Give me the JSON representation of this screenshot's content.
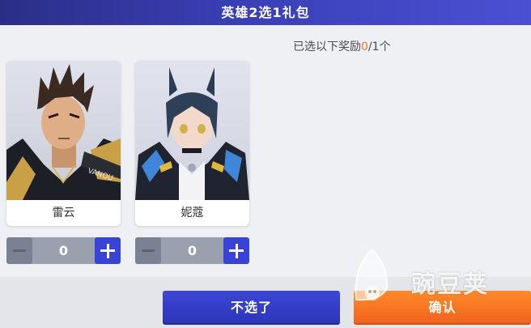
{
  "dialog": {
    "title": "英雄2选1礼包"
  },
  "selection": {
    "prefix": "已选以下奖励",
    "selected": "0",
    "separator": "/",
    "max": "1",
    "suffix": "个",
    "highlight_color": "#f07b2a"
  },
  "heroes": [
    {
      "name": "雷云",
      "quantity": "0",
      "portrait_icon": "hero-portrait-leiyun"
    },
    {
      "name": "妮蔻",
      "quantity": "0",
      "portrait_icon": "hero-portrait-nikou"
    }
  ],
  "buttons": {
    "skip_label": "不选了",
    "confirm_label": "确认",
    "skip_color": "#3a42d0",
    "confirm_color": "#f26e22"
  },
  "watermark": {
    "text": "豌豆荚",
    "icon": "pea-pod-logo-icon"
  }
}
